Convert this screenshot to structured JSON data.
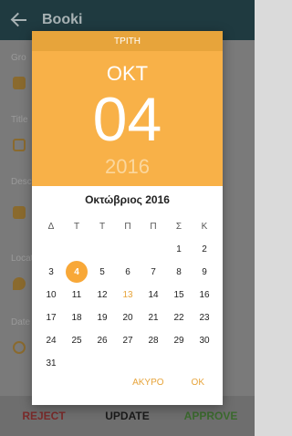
{
  "app": {
    "title": "Booki"
  },
  "background": {
    "labels": [
      "Gro",
      "Title",
      "Desc",
      "Locat",
      "Date"
    ]
  },
  "bottom_bar": {
    "reject": "REJECT",
    "update": "UPDATE",
    "approve": "APPROVE"
  },
  "dialog": {
    "weekday": "ΤΡΙΤΗ",
    "month_short": "ΟΚΤ",
    "day": "04",
    "year": "2016",
    "month_title": "Οκτώβριος 2016",
    "weekday_headers": [
      "Δ",
      "Τ",
      "Τ",
      "Π",
      "Π",
      "Σ",
      "Κ"
    ],
    "weeks": [
      [
        "",
        "",
        "",
        "",
        "",
        "1",
        "2"
      ],
      [
        "3",
        "4",
        "5",
        "6",
        "7",
        "8",
        "9"
      ],
      [
        "10",
        "11",
        "12",
        "13",
        "14",
        "15",
        "16"
      ],
      [
        "17",
        "18",
        "19",
        "20",
        "21",
        "22",
        "23"
      ],
      [
        "24",
        "25",
        "26",
        "27",
        "28",
        "29",
        "30"
      ],
      [
        "31",
        "",
        "",
        "",
        "",
        "",
        ""
      ]
    ],
    "selected_day": "4",
    "today_day": "13",
    "cancel": "ΑΚΥΡΟ",
    "ok": "OK"
  },
  "colors": {
    "accent": "#f8b148",
    "accent_dark": "#e7a43b",
    "app_bar": "#1f3a40"
  }
}
